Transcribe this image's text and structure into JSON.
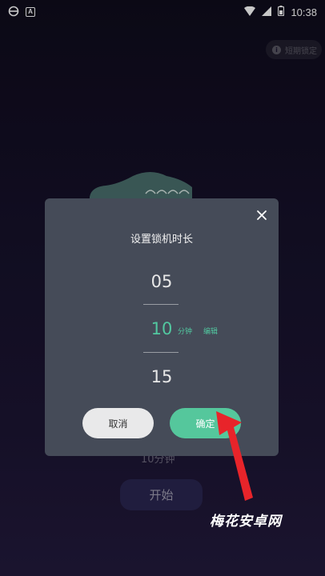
{
  "status_bar": {
    "time": "10:38"
  },
  "top_chip": {
    "label": "短期锁定"
  },
  "background": {
    "behind_text": "10分钟 ⌒",
    "start_label": "开始"
  },
  "dialog": {
    "title": "设置锁机时长",
    "picker": {
      "prev": "05",
      "selected": "10",
      "next": "15",
      "unit": "分钟",
      "edit": "编辑"
    },
    "cancel_label": "取消",
    "confirm_label": "确定"
  },
  "watermark": "梅花安卓网",
  "colors": {
    "accent": "#55c79c",
    "dialog_bg": "#454b58",
    "arrow": "#e8242a"
  }
}
